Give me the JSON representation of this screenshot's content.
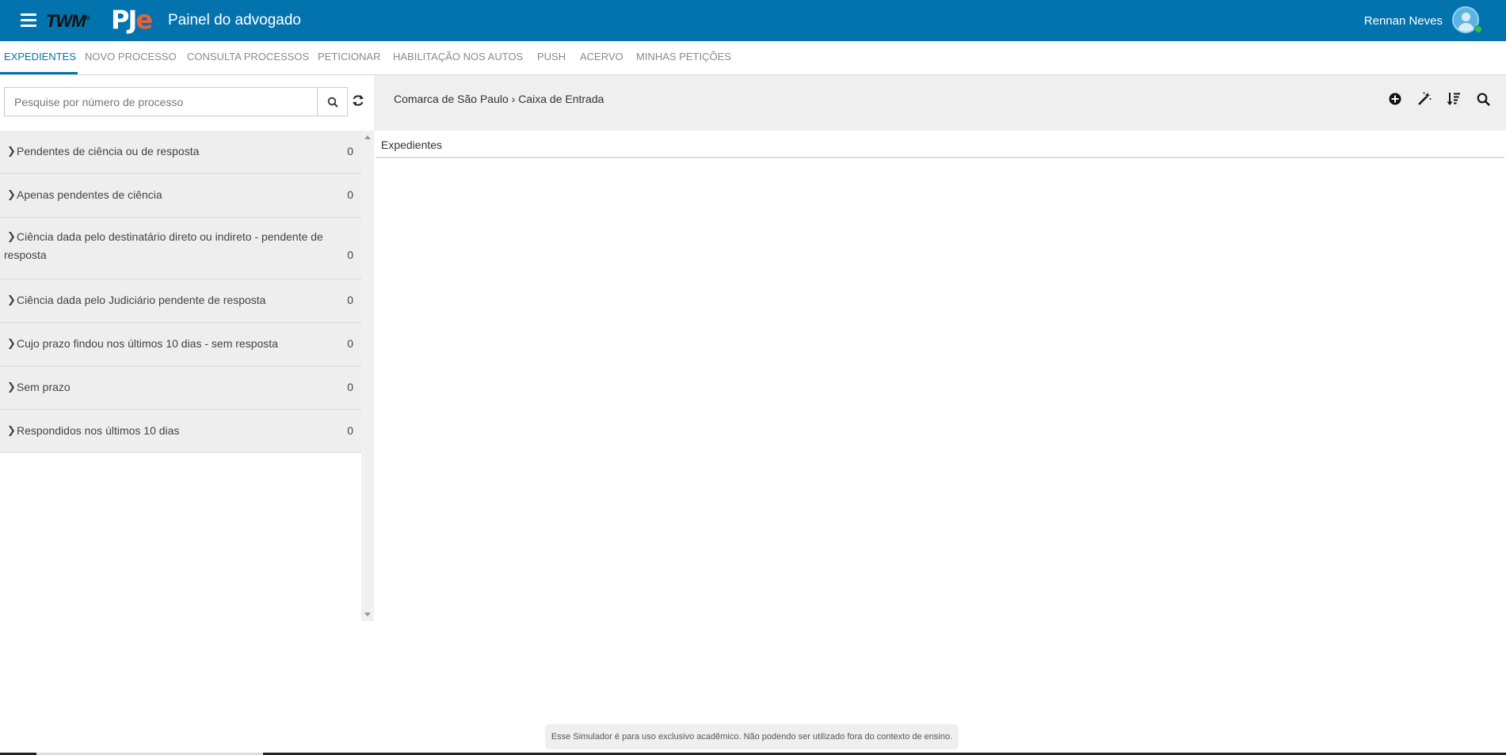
{
  "header": {
    "brand_twm": "TWM",
    "brand_pje_p": "PJ",
    "brand_pje_e": "e",
    "title": "Painel do advogado",
    "username": "Rennan Neves",
    "accent_color": "#0373ad"
  },
  "tabs": [
    {
      "label": "EXPEDIENTES",
      "active": true
    },
    {
      "label": "NOVO PROCESSO",
      "active": false
    },
    {
      "label": "CONSULTA PROCESSOS",
      "active": false
    },
    {
      "label": "PETICIONAR",
      "active": false
    },
    {
      "label": "HABILITAÇÃO NOS AUTOS",
      "active": false
    },
    {
      "label": "PUSH",
      "active": false
    },
    {
      "label": "ACERVO",
      "active": false
    },
    {
      "label": "MINHAS PETIÇÕES",
      "active": false
    }
  ],
  "search": {
    "placeholder": "Pesquise por número de processo",
    "value": ""
  },
  "expedientes_list": [
    {
      "label": "Pendentes de ciência ou de resposta",
      "count": "0"
    },
    {
      "label": "Apenas pendentes de ciência",
      "count": "0"
    },
    {
      "label": "Ciência dada pelo destinatário direto ou indireto - pendente de resposta",
      "count": "0"
    },
    {
      "label": "Ciência dada pelo Judiciário pendente de resposta",
      "count": "0"
    },
    {
      "label": "Cujo prazo findou nos últimos 10 dias - sem resposta",
      "count": "0"
    },
    {
      "label": "Sem prazo",
      "count": "0"
    },
    {
      "label": "Respondidos nos últimos 10 dias",
      "count": "0"
    }
  ],
  "main": {
    "breadcrumb_location": "Comarca de São Paulo",
    "breadcrumb_separator": "›",
    "breadcrumb_folder": "Caixa de Entrada",
    "panel_title": "Expedientes",
    "toolbar_icons": [
      "plus-circle-icon",
      "magic-wand-icon",
      "sort-icon",
      "search-icon"
    ]
  },
  "footer": {
    "disclaimer": "Esse Simulador é para uso exclusivo acadêmico. Não podendo ser utilizado fora do contexto de ensino."
  }
}
